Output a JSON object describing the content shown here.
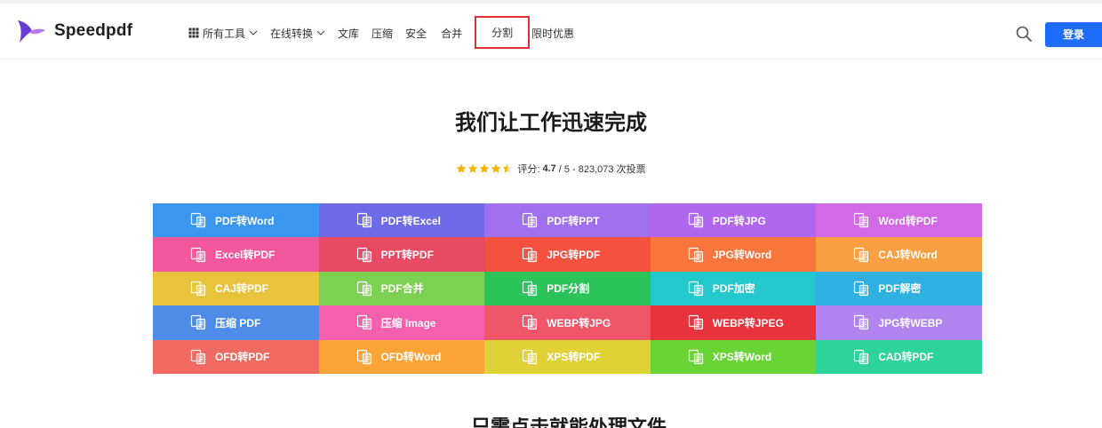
{
  "header": {
    "brand": "Speedpdf",
    "brand_colors": {
      "wing_a": "#6b3bd6",
      "wing_b": "#b77be8"
    },
    "nav": [
      {
        "label": "所有工具",
        "icon": "grid-icon",
        "dropdown": true
      },
      {
        "label": "在线转换",
        "dropdown": true
      },
      {
        "label": "文库"
      },
      {
        "label": "压缩"
      },
      {
        "label": "安全"
      },
      {
        "label": "合并"
      },
      {
        "label": "分割",
        "highlighted": true
      },
      {
        "label": "限时优惠"
      }
    ],
    "search_icon": "search-icon",
    "login_label": "登录",
    "accent": "#1e6dfa"
  },
  "hero": {
    "title": "我们让工作迅速完成",
    "rating_prefix": "评分:",
    "rating_value": "4.7",
    "rating_suffix": "/ 5 - 823,073 次投票",
    "stars": 4.5,
    "star_color": "#f5b400"
  },
  "tools": [
    {
      "label": "PDF转Word",
      "color": "#3b96ef",
      "icon": "pdf-to-word-icon"
    },
    {
      "label": "PDF转Excel",
      "color": "#6f6ae6",
      "icon": "pdf-to-excel-icon"
    },
    {
      "label": "PDF转PPT",
      "color": "#a070f0",
      "icon": "pdf-to-ppt-icon"
    },
    {
      "label": "PDF转JPG",
      "color": "#b067f0",
      "icon": "pdf-to-jpg-icon"
    },
    {
      "label": "Word转PDF",
      "color": "#d26ae6",
      "icon": "word-to-pdf-icon"
    },
    {
      "label": "Excel转PDF",
      "color": "#f4579c",
      "icon": "excel-to-pdf-icon"
    },
    {
      "label": "PPT转PDF",
      "color": "#e84a64",
      "icon": "ppt-to-pdf-icon"
    },
    {
      "label": "JPG转PDF",
      "color": "#f4513f",
      "icon": "jpg-to-pdf-icon"
    },
    {
      "label": "JPG转Word",
      "color": "#f8753c",
      "icon": "jpg-to-word-icon"
    },
    {
      "label": "CAJ转Word",
      "color": "#fb9f43",
      "icon": "caj-to-word-icon"
    },
    {
      "label": "CAJ转PDF",
      "color": "#e8c33c",
      "icon": "caj-to-pdf-icon"
    },
    {
      "label": "PDF合并",
      "color": "#7ed054",
      "icon": "pdf-merge-icon"
    },
    {
      "label": "PDF分割",
      "color": "#2bc45a",
      "icon": "pdf-split-icon"
    },
    {
      "label": "PDF加密",
      "color": "#22c8cc",
      "icon": "pdf-encrypt-icon"
    },
    {
      "label": "PDF解密",
      "color": "#2eb0e0",
      "icon": "pdf-decrypt-icon"
    },
    {
      "label": "压缩 PDF",
      "color": "#4f8ce8",
      "icon": "compress-pdf-icon"
    },
    {
      "label": "压缩 Image",
      "color": "#f45fae",
      "icon": "compress-image-icon"
    },
    {
      "label": "WEBP转JPG",
      "color": "#f0566a",
      "icon": "webp-to-jpg-icon"
    },
    {
      "label": "WEBP转JPEG",
      "color": "#e8323c",
      "icon": "webp-to-jpeg-icon"
    },
    {
      "label": "JPG转WEBP",
      "color": "#b184f0",
      "icon": "jpg-to-webp-icon"
    },
    {
      "label": "OFD转PDF",
      "color": "#f06a62",
      "icon": "ofd-to-pdf-icon"
    },
    {
      "label": "OFD转Word",
      "color": "#fca438",
      "icon": "ofd-to-word-icon"
    },
    {
      "label": "XPS转PDF",
      "color": "#e0d236",
      "icon": "xps-to-pdf-icon"
    },
    {
      "label": "XPS转Word",
      "color": "#6ad437",
      "icon": "xps-to-word-icon"
    },
    {
      "label": "CAD转PDF",
      "color": "#2fd49a",
      "icon": "cad-to-pdf-icon"
    }
  ],
  "next_section_title": "只需点击就能处理文件"
}
